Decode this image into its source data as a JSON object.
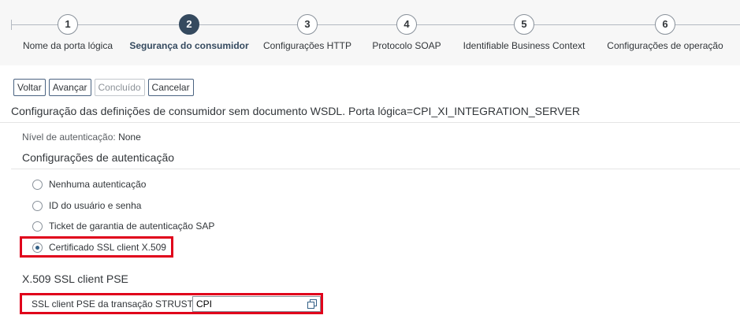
{
  "wizard": {
    "steps": [
      {
        "number": "1",
        "label": "Nome da porta lógica"
      },
      {
        "number": "2",
        "label": "Segurança do consumidor"
      },
      {
        "number": "3",
        "label": "Configurações HTTP"
      },
      {
        "number": "4",
        "label": "Protocolo SOAP"
      },
      {
        "number": "5",
        "label": "Identifiable Business Context"
      },
      {
        "number": "6",
        "label": "Configurações de operação"
      }
    ],
    "active_step": 2
  },
  "toolbar": {
    "back_label": "Voltar",
    "next_label": "Avançar",
    "finish_label": "Concluído",
    "cancel_label": "Cancelar"
  },
  "page_title": "Configuração das definições de consumidor sem documento WSDL. Porta lógica=CPI_XI_INTEGRATION_SERVER",
  "auth_level": {
    "label": "Nível de autenticação:",
    "value": "None"
  },
  "auth_settings": {
    "title": "Configurações de autenticação",
    "options": [
      {
        "label": "Nenhuma autenticação",
        "selected": false
      },
      {
        "label": "ID do usuário e senha",
        "selected": false
      },
      {
        "label": "Ticket de garantia de autenticação SAP",
        "selected": false
      },
      {
        "label": "Certificado SSL client X.509",
        "selected": true
      }
    ]
  },
  "pse": {
    "title": "X.509 SSL client PSE",
    "field_label": "SSL client PSE da transação STRUST:",
    "field_value": "CPI",
    "value_help_icon": "value-help-icon"
  },
  "colors": {
    "active_step": "#354a5f",
    "highlight": "#e0001b",
    "button_border": "#4a6381"
  }
}
